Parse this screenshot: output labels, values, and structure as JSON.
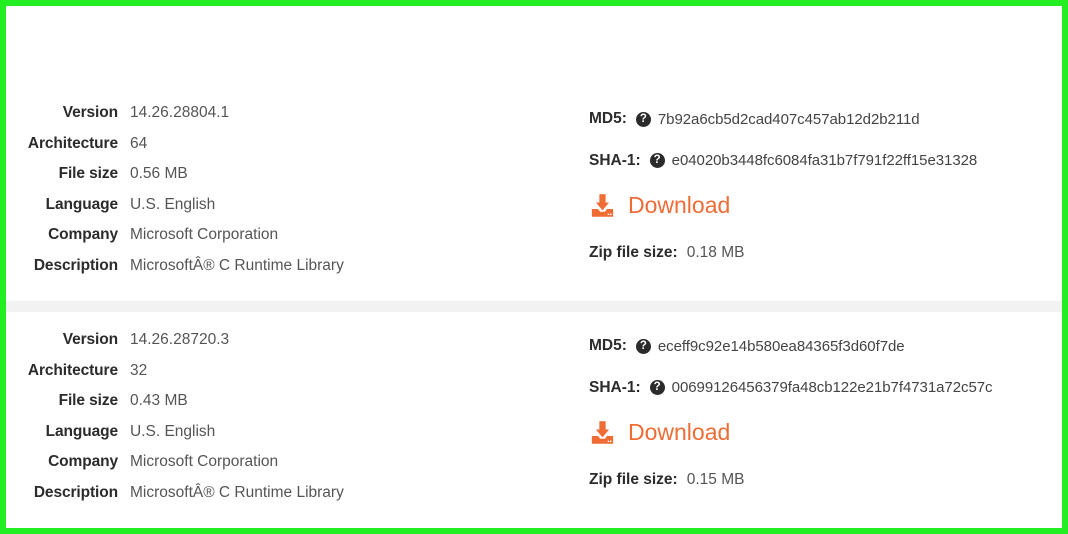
{
  "theme": {
    "frame_border_color": "#22ee22",
    "accent_color": "#ef6c35",
    "label_color": "#2b2b2b",
    "value_color": "#555555",
    "divider_color": "#f2f2f2",
    "background": "#ffffff"
  },
  "labels": {
    "version": "Version",
    "architecture": "Architecture",
    "file_size": "File size",
    "language": "Language",
    "company": "Company",
    "description": "Description",
    "md5": "MD5:",
    "sha1": "SHA-1:",
    "zip_file_size": "Zip file size:",
    "download": "Download",
    "help_glyph": "?"
  },
  "records": [
    {
      "version": "14.26.28804.1",
      "architecture": "64",
      "file_size": "0.56 MB",
      "language": "U.S. English",
      "company": "Microsoft Corporation",
      "description": "MicrosoftÂ® C Runtime Library",
      "md5": "7b92a6cb5d2cad407c457ab12d2b211d",
      "sha1": "e04020b3448fc6084fa31b7f791f22ff15e31328",
      "zip_file_size": "0.18 MB"
    },
    {
      "version": "14.26.28720.3",
      "architecture": "32",
      "file_size": "0.43 MB",
      "language": "U.S. English",
      "company": "Microsoft Corporation",
      "description": "MicrosoftÂ® C Runtime Library",
      "md5": "eceff9c92e14b580ea84365f3d60f7de",
      "sha1": "00699126456379fa48cb122e21b7f4731a72c57c",
      "zip_file_size": "0.15 MB"
    }
  ]
}
